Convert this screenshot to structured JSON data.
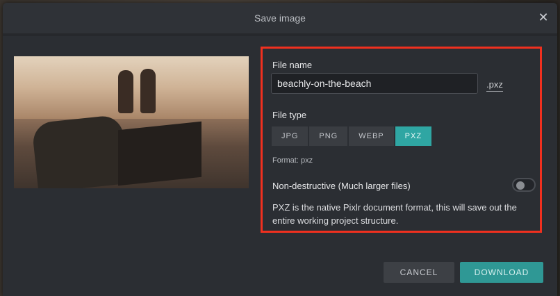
{
  "dialog": {
    "title": "Save image",
    "close_icon": "close-icon"
  },
  "form": {
    "file_name_label": "File name",
    "file_name_value": "beachly-on-the-beach",
    "extension": ".pxz",
    "file_type_label": "File type",
    "file_types": [
      {
        "label": "JPG",
        "active": false
      },
      {
        "label": "PNG",
        "active": false
      },
      {
        "label": "WEBP",
        "active": false
      },
      {
        "label": "PXZ",
        "active": true
      }
    ],
    "format_text": "Format: pxz",
    "non_destructive_label": "Non-destructive (Much larger files)",
    "non_destructive_enabled": false,
    "description": "PXZ is the native Pixlr document format, this will save out the entire working project structure."
  },
  "actions": {
    "cancel_label": "CANCEL",
    "download_label": "DOWNLOAD"
  },
  "colors": {
    "accent": "#2fa6a3",
    "highlight_border": "#f0301f"
  }
}
